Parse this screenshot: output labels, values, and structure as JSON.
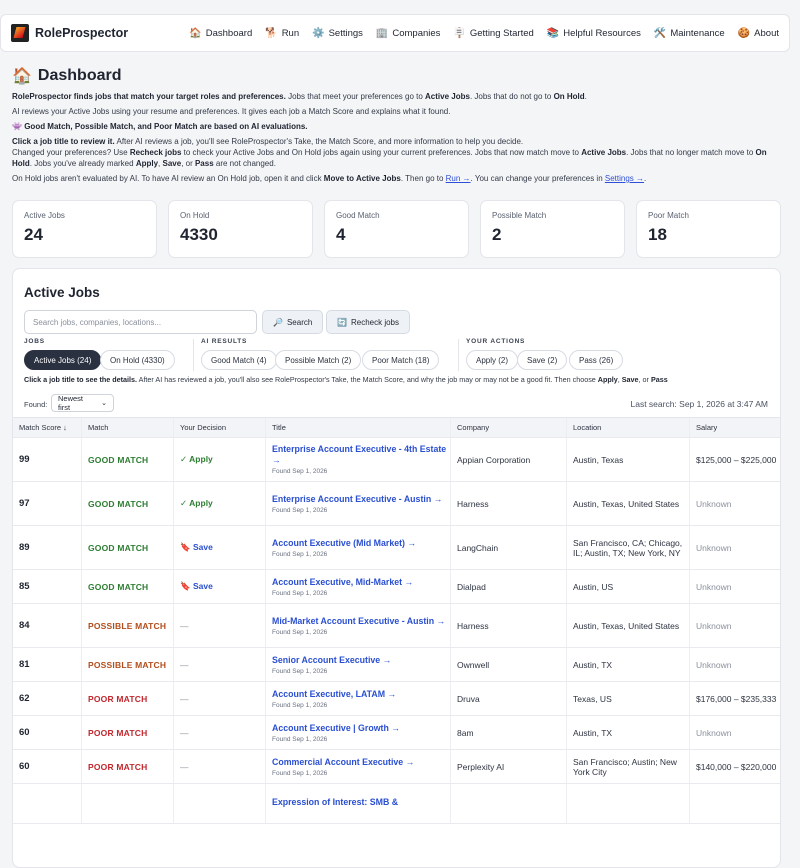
{
  "brand": {
    "name": "RoleProspector"
  },
  "nav": [
    {
      "icon": "🏠",
      "label": "Dashboard"
    },
    {
      "icon": "🐕",
      "label": "Run"
    },
    {
      "icon": "⚙️",
      "label": "Settings"
    },
    {
      "icon": "🏢",
      "label": "Companies"
    },
    {
      "icon": "🪧",
      "label": "Getting Started"
    },
    {
      "icon": "📚",
      "label": "Helpful Resources"
    },
    {
      "icon": "🛠️",
      "label": "Maintenance"
    },
    {
      "icon": "🍪",
      "label": "About"
    }
  ],
  "page": {
    "icon": "🏠",
    "title": "Dashboard",
    "intro": {
      "p1_bold": "RoleProspector finds jobs that match your target roles and preferences.",
      "p1_a": " Jobs that meet your preferences go to ",
      "p1_b1": "Active Jobs",
      "p1_c": ". Jobs that do not go to ",
      "p1_b2": "On Hold",
      "p1_d": ".",
      "p2": "AI reviews your Active Jobs using your resume and preferences. It gives each job a Match Score and explains what it found.",
      "p3_icon": "👾",
      "p3_bold": "Good Match, Possible Match, and Poor Match are based on AI evaluations.",
      "p4_bold": "Click a job title to review it.",
      "p4_a": " After AI reviews a job, you'll see RoleProspector's Take, the Match Score, and more information to help you decide.",
      "p5_a": "Changed your preferences? Use ",
      "p5_b1": "Recheck jobs",
      "p5_b": " to check your Active Jobs and On Hold jobs again using your current preferences. Jobs that now match move to ",
      "p5_b2": "Active Jobs",
      "p5_c": ". Jobs that no longer match move to ",
      "p5_b3": "On Hold",
      "p5_d": ". Jobs you've already marked ",
      "p5_b4": "Apply",
      "p5_e": ", ",
      "p5_b5": "Save",
      "p5_f": ", or ",
      "p5_b6": "Pass",
      "p5_g": " are not changed.",
      "p6_a": "On Hold jobs aren't evaluated by AI. To have AI review an On Hold job, open it and click ",
      "p6_b1": "Move to Active Jobs",
      "p6_b": ". Then go to ",
      "p6_link1": "Run →",
      "p6_c": ". You can change your preferences in ",
      "p6_link2": "Settings →",
      "p6_d": "."
    }
  },
  "stats": [
    {
      "label": "Active Jobs",
      "value": "24"
    },
    {
      "label": "On Hold",
      "value": "4330"
    },
    {
      "label": "Good Match",
      "value": "4"
    },
    {
      "label": "Possible Match",
      "value": "2"
    },
    {
      "label": "Poor Match",
      "value": "18"
    }
  ],
  "active_jobs": {
    "title": "Active Jobs",
    "search_placeholder": "Search jobs, companies, locations...",
    "search_button": "Search",
    "recheck_button": "Recheck jobs",
    "groups": {
      "jobs": {
        "label": "JOBS",
        "pills": [
          "Active Jobs (24)",
          "On Hold (4330)"
        ]
      },
      "ai": {
        "label": "AI RESULTS",
        "pills": [
          "Good Match (4)",
          "Possible Match (2)",
          "Poor Match (18)"
        ]
      },
      "actions": {
        "label": "YOUR ACTIONS",
        "pills": [
          "Apply (2)",
          "Save (2)",
          "Pass (26)"
        ]
      }
    },
    "helper": {
      "bold": "Click a job title to see the details.",
      "a": " After AI has reviewed a job, you'll also see RoleProspector's Take, the Match Score, and why the job may or may not be a good fit. Then choose ",
      "b1": "Apply",
      "b": ", ",
      "b2": "Save",
      "c": ", or ",
      "b3": "Pass"
    },
    "found_label": "Found:",
    "sort_value": "Newest first",
    "last_search": "Last search: Sep 1, 2026 at 3:47 AM",
    "columns": [
      "Match Score ↓",
      "Match",
      "Your Decision",
      "Title",
      "Company",
      "Location",
      "Salary"
    ],
    "rows": [
      {
        "score": "99",
        "match": "GOOD MATCH",
        "mclass": "good",
        "decision": "✓ Apply",
        "dclass": "apply",
        "title": "Enterprise Account Executive - 4th Estate →",
        "found": "Found Sep 1, 2026",
        "company": "Appian Corporation",
        "location": "Austin, Texas",
        "salary": "$125,000 – $225,000"
      },
      {
        "score": "97",
        "match": "GOOD MATCH",
        "mclass": "good",
        "decision": "✓ Apply",
        "dclass": "apply",
        "title": "Enterprise Account Executive - Austin →",
        "found": "Found Sep 1, 2026",
        "company": "Harness",
        "location": "Austin, Texas, United States",
        "salary": "Unknown"
      },
      {
        "score": "89",
        "match": "GOOD MATCH",
        "mclass": "good",
        "decision": "🔖 Save",
        "dclass": "save",
        "title": "Account Executive (Mid Market) →",
        "found": "Found Sep 1, 2026",
        "company": "LangChain",
        "location": "San Francisco, CA; Chicago, IL; Austin, TX; New York, NY",
        "salary": "Unknown"
      },
      {
        "score": "85",
        "match": "GOOD MATCH",
        "mclass": "good",
        "decision": "🔖 Save",
        "dclass": "save",
        "title": "Account Executive, Mid-Market →",
        "found": "Found Sep 1, 2026",
        "company": "Dialpad",
        "location": "Austin, US",
        "salary": "Unknown"
      },
      {
        "score": "84",
        "match": "POSSIBLE MATCH",
        "mclass": "possible",
        "decision": "—",
        "dclass": "none",
        "title": "Mid-Market Account Executive - Austin →",
        "found": "Found Sep 1, 2026",
        "company": "Harness",
        "location": "Austin, Texas, United States",
        "salary": "Unknown"
      },
      {
        "score": "81",
        "match": "POSSIBLE MATCH",
        "mclass": "possible",
        "decision": "—",
        "dclass": "none",
        "title": "Senior Account Executive →",
        "found": "Found Sep 1, 2026",
        "company": "Ownwell",
        "location": "Austin, TX",
        "salary": "Unknown"
      },
      {
        "score": "62",
        "match": "POOR MATCH",
        "mclass": "poor",
        "decision": "—",
        "dclass": "none",
        "title": "Account Executive, LATAM →",
        "found": "Found Sep 1, 2026",
        "company": "Druva",
        "location": "Texas, US",
        "salary": "$176,000 – $235,333"
      },
      {
        "score": "60",
        "match": "POOR MATCH",
        "mclass": "poor",
        "decision": "—",
        "dclass": "none",
        "title": "Account Executive | Growth →",
        "found": "Found Sep 1, 2026",
        "company": "8am",
        "location": "Austin, TX",
        "salary": "Unknown"
      },
      {
        "score": "60",
        "match": "POOR MATCH",
        "mclass": "poor",
        "decision": "—",
        "dclass": "none",
        "title": "Commercial Account Executive →",
        "found": "Found Sep 1, 2026",
        "company": "Perplexity AI",
        "location": "San Francisco; Austin; New York City",
        "salary": "$140,000 – $220,000"
      },
      {
        "score": "",
        "match": "",
        "mclass": "",
        "decision": "",
        "dclass": "",
        "title": "Expression of Interest: SMB &",
        "found": "",
        "company": "",
        "location": "",
        "salary": ""
      }
    ]
  },
  "colors": {
    "accent": "#2a4fd0",
    "good": "#2e7d32",
    "possible": "#b34d1b",
    "poor": "#c1272d",
    "dark_pill": "#2a3141"
  }
}
